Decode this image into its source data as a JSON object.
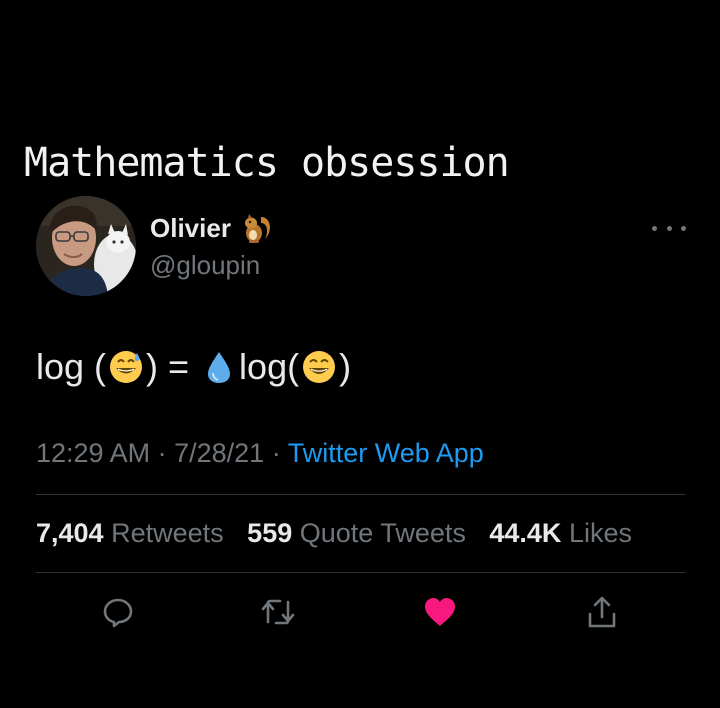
{
  "caption": "Mathematics obsession",
  "author": {
    "display_name": "Olivier",
    "handle": "@gloupin"
  },
  "tweet": {
    "text_log_open": "log (",
    "text_close_equals": ") =",
    "text_log2_open": "log(",
    "text_close": ")"
  },
  "meta": {
    "time": "12:29 AM",
    "separator": "·",
    "date": "7/28/21",
    "source": "Twitter Web App"
  },
  "stats": {
    "retweets_count": "7,404",
    "retweets_label": "Retweets",
    "quotes_count": "559",
    "quotes_label": "Quote Tweets",
    "likes_count": "44.4K",
    "likes_label": "Likes"
  },
  "icons": {
    "author_badge": "squirrel-emoji",
    "emoji_1": "grinning-face-with-sweat",
    "emoji_2": "droplet",
    "emoji_3": "grinning-face-with-smiling-eyes",
    "reply": "reply-icon",
    "retweet": "retweet-icon",
    "like": "heart-icon",
    "share": "share-icon"
  },
  "colors": {
    "background": "#000000",
    "accent": "#1d9bf0",
    "like": "#f91880",
    "secondary_text": "#71767b"
  }
}
